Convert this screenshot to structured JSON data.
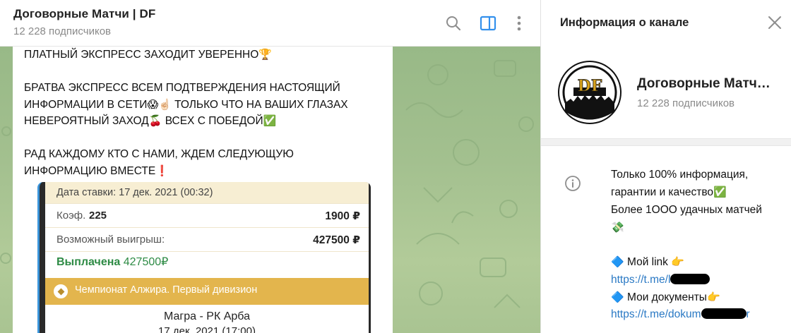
{
  "chat": {
    "title": "Договорные Матчи | DF",
    "subscribers": "12 228 подписчиков",
    "message": {
      "lines": [
        "ПЛАТНЫЙ ЭКСПРЕСС ЗАХОДИТ УВЕРЕННО",
        "",
        "БРАТВА ЭКСПРЕСС ВСЕМ ПОДТВЕРЖДЕНИЯ НАСТОЯЩИЙ",
        "ИНФОРМАЦИИ В СЕТИ",
        "ТОЛЬКО ЧТО НА ВАШИХ ГЛАЗАХ",
        "НЕВЕРОЯТНЫЙ ЗАХОД",
        "ВСЕХ С ПОБЕДОЙ",
        "",
        "РАД КАЖДОМУ КТО С НАМИ, ЖДЕМ СЛЕДУЮЩУЮ",
        "ИНФОРМАЦИЮ ВМЕСТЕ"
      ],
      "emoji": {
        "trophy": "🏆",
        "scream": "😱",
        "point_up": "☝🏻",
        "cherries": "🍒",
        "check": "✅",
        "exclamation": "❗"
      },
      "bet_slip": {
        "date": "Дата ставки: 17 дек. 2021 (00:32)",
        "coef_label": "Коэф.",
        "coef_value": "225",
        "stake": "1900 ₽",
        "win_label": "Возможный выигрыш:",
        "win_value": "427500 ₽",
        "paid_label": "Выплачена",
        "paid_value": "427500₽",
        "league": "Чемпионат Алжира. Первый дивизион",
        "teams": "Магра - РК Арба",
        "match_date": "17 дек. 2021 (17:00)"
      }
    }
  },
  "header_icons": [
    "search-icon",
    "sidebar-toggle-icon",
    "more-vertical-icon"
  ],
  "panel": {
    "title": "Информация о канале",
    "channel_name": "Договорные Матч…",
    "subscribers": "12 228 подписчиков",
    "avatar_text": "DF",
    "description": {
      "line1": "Только 100% информация,",
      "line2": "гарантии и качество",
      "line3": "Более 1ООО удачных матчей",
      "money_emoji": "💸",
      "my_link_label": "Мой link",
      "my_link_url": "https://t.me/l",
      "my_docs_label": "Мои документы",
      "my_docs_url_start": "https://t.me/dokum",
      "my_docs_url_end": "r",
      "diamond": "🔷",
      "point_right": "👉",
      "check": "✅"
    }
  },
  "colors": {
    "accent": "#2a79c4",
    "sidebar_toggle_active": "#3390ec",
    "chat_bg": "#a3c08f",
    "paid_green": "#2e8b45",
    "league_bar": "#e3b54d"
  }
}
